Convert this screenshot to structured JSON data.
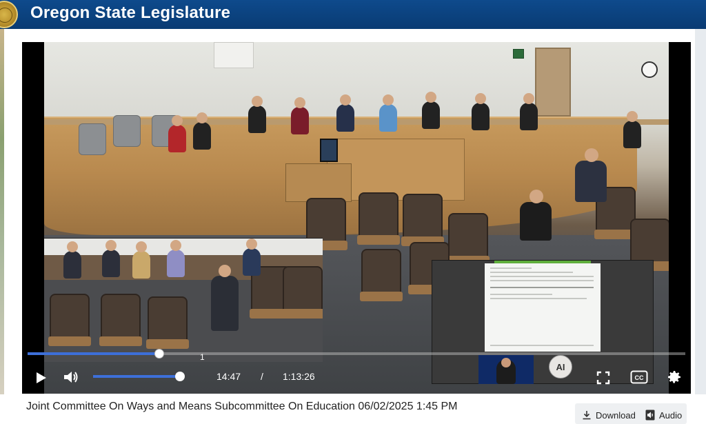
{
  "header": {
    "title": "Oregon State Legislature"
  },
  "player": {
    "current_time": "14:47",
    "separator": "/",
    "duration": "1:13:26",
    "progress_fraction": 0.2,
    "volume_fraction": 1.0,
    "chapter_marker": "1",
    "ai_label": "AI",
    "cc_label": "CC"
  },
  "video": {
    "title": "Joint Committee On Ways and Means Subcommittee On Education 06/02/2025 1:45 PM"
  },
  "actions": {
    "download_label": "Download",
    "audio_label": "Audio"
  },
  "colors": {
    "header_bg": "#0e4a8c",
    "progress_accent": "#3d6fd9"
  },
  "icons": [
    "seal-icon",
    "play-icon",
    "volume-icon",
    "fullscreen-icon",
    "cc-icon",
    "gear-icon",
    "download-icon",
    "audio-icon"
  ]
}
